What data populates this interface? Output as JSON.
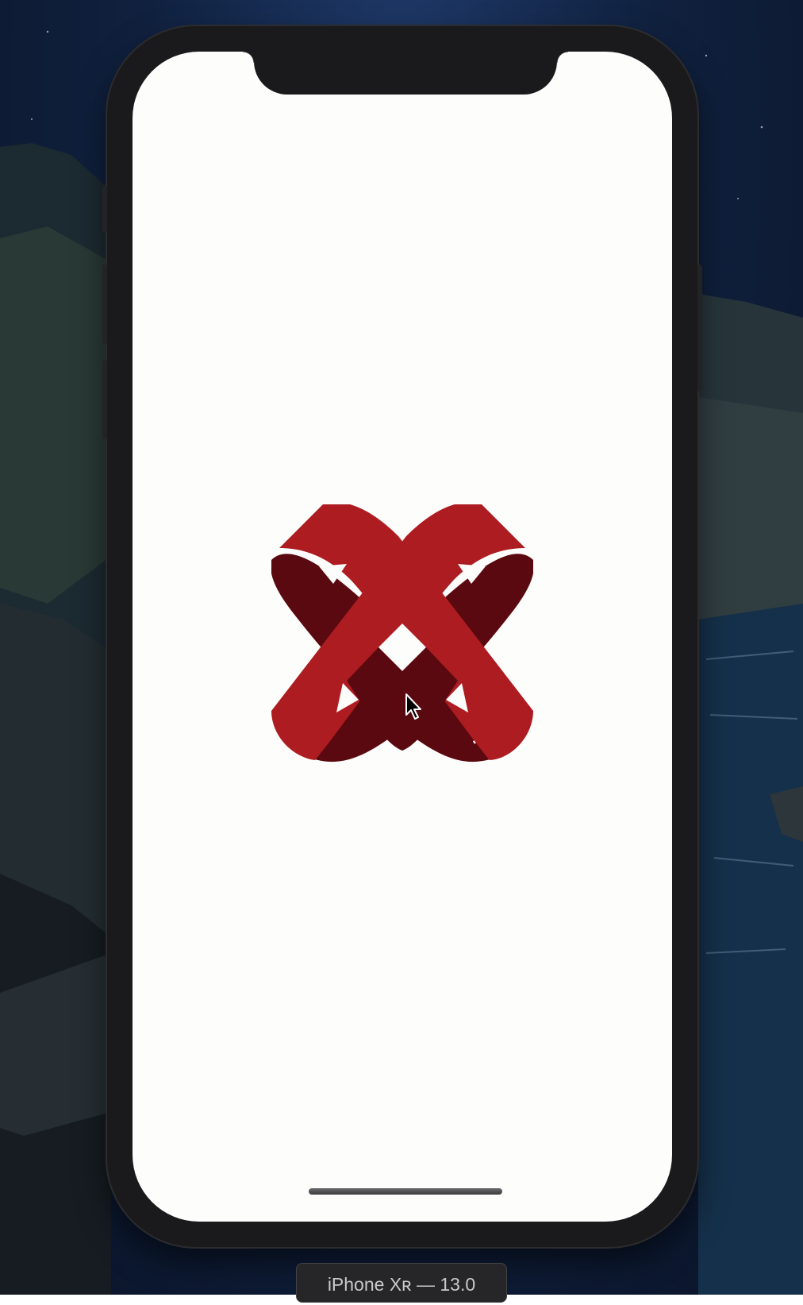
{
  "simulator": {
    "device_label": "iPhone Xʀ — 13.0"
  },
  "app": {
    "logo_icon": "ribbon-x-logo-icon",
    "colors": {
      "screen_background": "#fdfdfc",
      "ribbon_front": "#ad1c21",
      "ribbon_back": "#5b0910"
    }
  },
  "icons": {
    "cursor": "arrow-cursor-icon"
  }
}
